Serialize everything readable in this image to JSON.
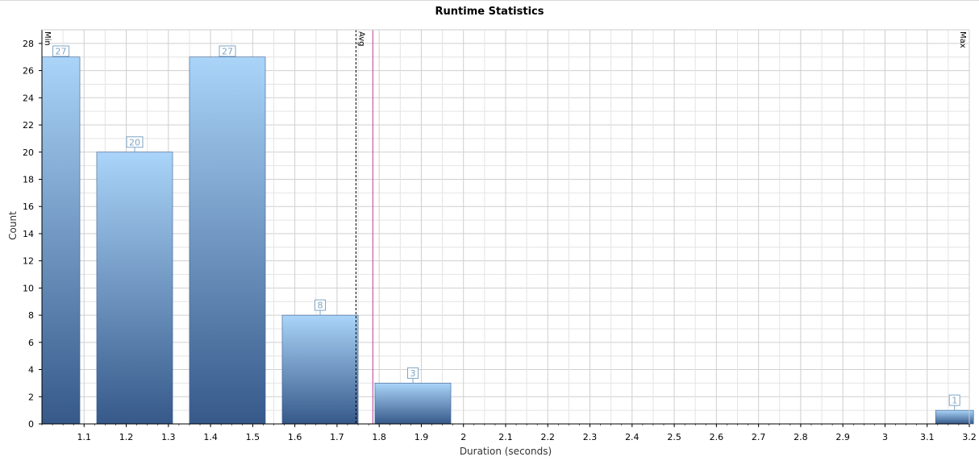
{
  "chart_data": {
    "type": "bar",
    "title": "Runtime Statistics",
    "xlabel": "Duration (seconds)",
    "ylabel": "Count",
    "xlim": [
      1.0,
      3.2
    ],
    "ylim": [
      0,
      29
    ],
    "x_ticks": [
      "1.1",
      "1.2",
      "1.3",
      "1.4",
      "1.5",
      "1.6",
      "1.7",
      "1.8",
      "1.9",
      "2",
      "2.1",
      "2.2",
      "2.3",
      "2.4",
      "2.5",
      "2.6",
      "2.7",
      "2.8",
      "2.9",
      "3",
      "3.1",
      "3.2"
    ],
    "y_ticks": [
      "0",
      "2",
      "4",
      "6",
      "8",
      "10",
      "12",
      "14",
      "16",
      "18",
      "20",
      "22",
      "24",
      "26",
      "28"
    ],
    "bars": [
      {
        "start": 1.0,
        "end": 1.09,
        "value": 27,
        "label": "27"
      },
      {
        "start": 1.13,
        "end": 1.31,
        "value": 20,
        "label": "20"
      },
      {
        "start": 1.35,
        "end": 1.53,
        "value": 27,
        "label": "27"
      },
      {
        "start": 1.57,
        "end": 1.75,
        "value": 8,
        "label": "8"
      },
      {
        "start": 1.79,
        "end": 1.97,
        "value": 3,
        "label": "3"
      },
      {
        "start": 3.12,
        "end": 3.21,
        "value": 1,
        "label": "1"
      }
    ],
    "markers": [
      {
        "label": "Min",
        "x": 1.0,
        "style": "solid",
        "color": "#999999"
      },
      {
        "label": "Avg",
        "x": 1.745,
        "style": "dashed",
        "color": "#000000"
      },
      {
        "label": "",
        "x": 1.785,
        "style": "solid",
        "color": "#c0399a"
      },
      {
        "label": "Max",
        "x": 3.2,
        "style": "solid",
        "color": "#999999"
      }
    ],
    "grid": true,
    "colors": {
      "bar_top": "#aad4f8",
      "bar_bottom": "#36598a",
      "bar_stroke": "#3a5f8f",
      "label_color": "#7fa6c4",
      "avg_line": "#000000",
      "median_line": "#c0399a"
    }
  }
}
